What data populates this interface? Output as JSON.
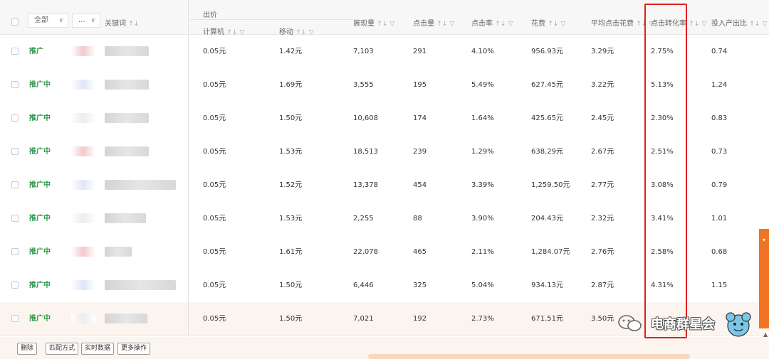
{
  "header": {
    "filter_all": "全部",
    "filter_dots": "...",
    "keyword": "关键词",
    "bid_group": "出价",
    "bid_pc": "计算机",
    "bid_mobile": "移动",
    "impressions": "展现量",
    "clicks": "点击量",
    "ctr": "点击率",
    "cost": "花费",
    "avg_cpc": "平均点击花费",
    "cvr": "点击转化率",
    "roi": "投入产出比",
    "sort_glyph": "↑↓",
    "filter_glyph": "▽"
  },
  "rows": [
    {
      "status": "推广",
      "pc": "0.05元",
      "mobile": "1.42元",
      "impressions": "7,103",
      "clicks": "291",
      "ctr": "4.10%",
      "cost": "956.93元",
      "avg_cpc": "3.29元",
      "cvr": "2.75%",
      "roi": "0.74"
    },
    {
      "status": "推广中",
      "pc": "0.05元",
      "mobile": "1.69元",
      "impressions": "3,555",
      "clicks": "195",
      "ctr": "5.49%",
      "cost": "627.45元",
      "avg_cpc": "3.22元",
      "cvr": "5.13%",
      "roi": "1.24"
    },
    {
      "status": "推广中",
      "pc": "0.05元",
      "mobile": "1.50元",
      "impressions": "10,608",
      "clicks": "174",
      "ctr": "1.64%",
      "cost": "425.65元",
      "avg_cpc": "2.45元",
      "cvr": "2.30%",
      "roi": "0.83"
    },
    {
      "status": "推广中",
      "pc": "0.05元",
      "mobile": "1.53元",
      "impressions": "18,513",
      "clicks": "239",
      "ctr": "1.29%",
      "cost": "638.29元",
      "avg_cpc": "2.67元",
      "cvr": "2.51%",
      "roi": "0.73"
    },
    {
      "status": "推广中",
      "pc": "0.05元",
      "mobile": "1.52元",
      "impressions": "13,378",
      "clicks": "454",
      "ctr": "3.39%",
      "cost": "1,259.50元",
      "avg_cpc": "2.77元",
      "cvr": "3.08%",
      "roi": "0.79"
    },
    {
      "status": "推广中",
      "pc": "0.05元",
      "mobile": "1.53元",
      "impressions": "2,255",
      "clicks": "88",
      "ctr": "3.90%",
      "cost": "204.43元",
      "avg_cpc": "2.32元",
      "cvr": "3.41%",
      "roi": "1.01"
    },
    {
      "status": "推广中",
      "pc": "0.05元",
      "mobile": "1.61元",
      "impressions": "22,078",
      "clicks": "465",
      "ctr": "2.11%",
      "cost": "1,284.07元",
      "avg_cpc": "2.76元",
      "cvr": "2.58%",
      "roi": "0.68"
    },
    {
      "status": "推广中",
      "pc": "0.05元",
      "mobile": "1.50元",
      "impressions": "6,446",
      "clicks": "325",
      "ctr": "5.04%",
      "cost": "934.13元",
      "avg_cpc": "2.87元",
      "cvr": "4.31%",
      "roi": "1.15"
    },
    {
      "status": "推广中",
      "pc": "0.05元",
      "mobile": "1.50元",
      "impressions": "7,021",
      "clicks": "192",
      "ctr": "2.73%",
      "cost": "671.51元",
      "avg_cpc": "3.50元",
      "cvr": "",
      "roi": ""
    }
  ],
  "footer": {
    "delete": "删除",
    "match_type": "匹配方式",
    "realtime": "实时数据",
    "more": "更多操作"
  },
  "watermark": {
    "text": "电商群星会"
  },
  "colors": {
    "status_green": "#2e9a4a",
    "highlight_red": "#e02020",
    "side_orange": "#f07424"
  },
  "icons": [
    "wechat-icon",
    "mascot-icon",
    "chevron-down-icon",
    "checkbox-icon"
  ]
}
